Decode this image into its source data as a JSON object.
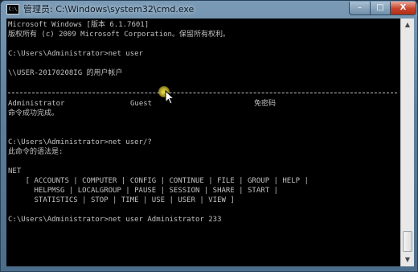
{
  "window": {
    "icon_text": "C:\\",
    "title": "管理员: C:\\Windows\\system32\\cmd.exe",
    "controls": {
      "minimize": "–",
      "maximize": "□",
      "close": "X"
    }
  },
  "console": {
    "lines": [
      "Microsoft Windows [版本 6.1.7601]",
      "版权所有 (c) 2009 Microsoft Corporation。保留所有权利。",
      "",
      "C:\\Users\\Administrator>net user",
      "",
      "\\\\USER-20170208IG 的用户帐户",
      "",
      "",
      "",
      "命令成功完成。",
      "",
      "",
      "C:\\Users\\Administrator>net user/?",
      "此命令的语法是:",
      "",
      "NET",
      "    [ ACCOUNTS | COMPUTER | CONFIG | CONTINUE | FILE | GROUP | HELP |",
      "      HELPMSG | LOCALGROUP | PAUSE | SESSION | SHARE | START |",
      "      STATISTICS | STOP | TIME | USE | USER | VIEW ]",
      "",
      "C:\\Users\\Administrator>net user Administrator 233"
    ],
    "accounts": [
      "Administrator",
      "Guest",
      "免密码"
    ]
  }
}
